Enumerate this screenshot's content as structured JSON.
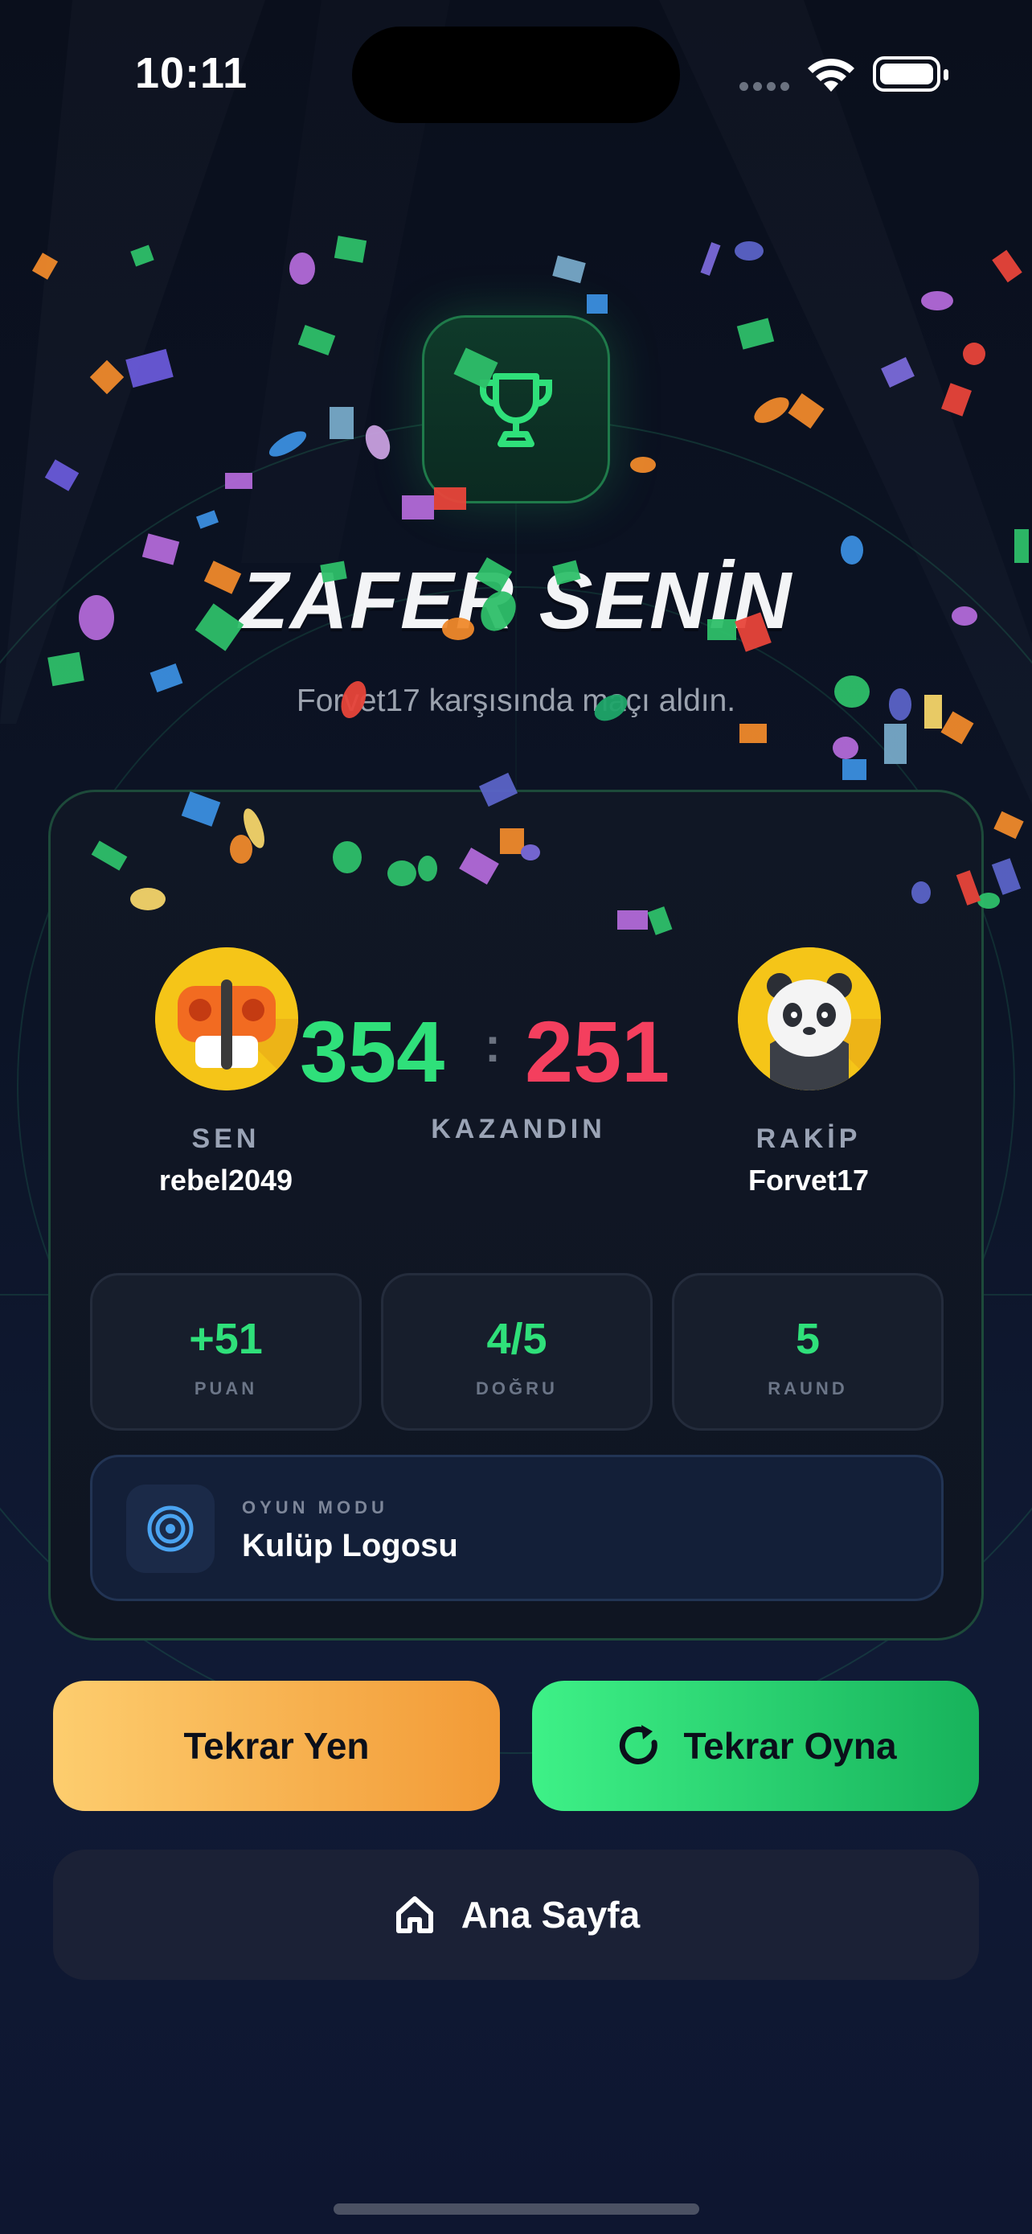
{
  "status_bar": {
    "time": "10:11"
  },
  "result": {
    "title": "ZAFER SENİN",
    "subtitle": "Forvet17 karşısında maçı aldın."
  },
  "players": {
    "you": {
      "label": "SEN",
      "name": "rebel2049",
      "score": "354"
    },
    "opponent": {
      "label": "RAKİP",
      "name": "Forvet17",
      "score": "251"
    },
    "separator": ":",
    "result_label": "KAZANDIN"
  },
  "stats": [
    {
      "value": "+51",
      "label": "PUAN"
    },
    {
      "value": "4/5",
      "label": "DOĞRU"
    },
    {
      "value": "5",
      "label": "RAUND"
    }
  ],
  "mode": {
    "label": "OYUN MODU",
    "value": "Kulüp Logosu"
  },
  "buttons": {
    "rematch": "Tekrar Yen",
    "replay": "Tekrar Oyna",
    "home": "Ana Sayfa"
  },
  "icons": {
    "trophy": "trophy-icon",
    "mode": "target-icon",
    "replay": "refresh-icon",
    "home": "home-icon"
  },
  "colors": {
    "win_green": "#2fe07a",
    "lose_red": "#f43f5e",
    "rematch_gradient": [
      "#fdcd6e",
      "#f29a36"
    ],
    "replay_gradient": [
      "#3ef187",
      "#17b25b"
    ]
  }
}
